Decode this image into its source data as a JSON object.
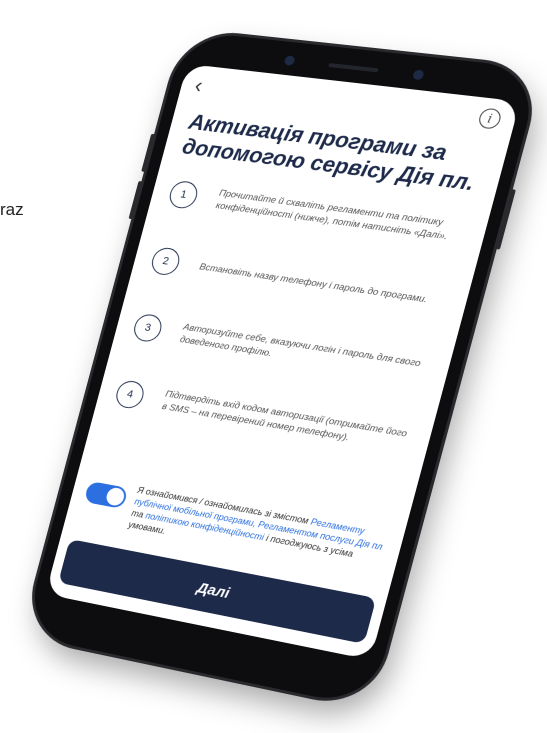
{
  "side_text": "raz",
  "screen": {
    "back_glyph": "‹",
    "info_glyph": "i",
    "title": "Активація програми за допомогою сервісу Дія пл.",
    "steps": [
      {
        "num": "1",
        "text": "Прочитайте й схваліть регламенти та політику конфіденційності (нижче), потім натисніть «Далі»."
      },
      {
        "num": "2",
        "text": "Встановіть назву телефону і пароль до програми."
      },
      {
        "num": "3",
        "text": "Авторизуйте себе, вказуючи логін і пароль для свого доведеного профілю."
      },
      {
        "num": "4",
        "text": "Підтвердіть вхід кодом авторизації (отримайте його в SMS – на перевірений номер телефону)."
      }
    ],
    "consent": {
      "text_a": "Я ознайомився / ознайомилась зі змістом ",
      "link_a": "Регламенту публічної мобільної програми, Регламентом послуги Дія пл",
      "text_b": " та ",
      "link_b": "політикою конфіденційності",
      "text_c": " і погоджуюсь з усіма умовами.",
      "toggle_on": true
    },
    "next_label": "Далі"
  },
  "colors": {
    "accent": "#2b6fe0",
    "primary": "#1d2a4a"
  }
}
